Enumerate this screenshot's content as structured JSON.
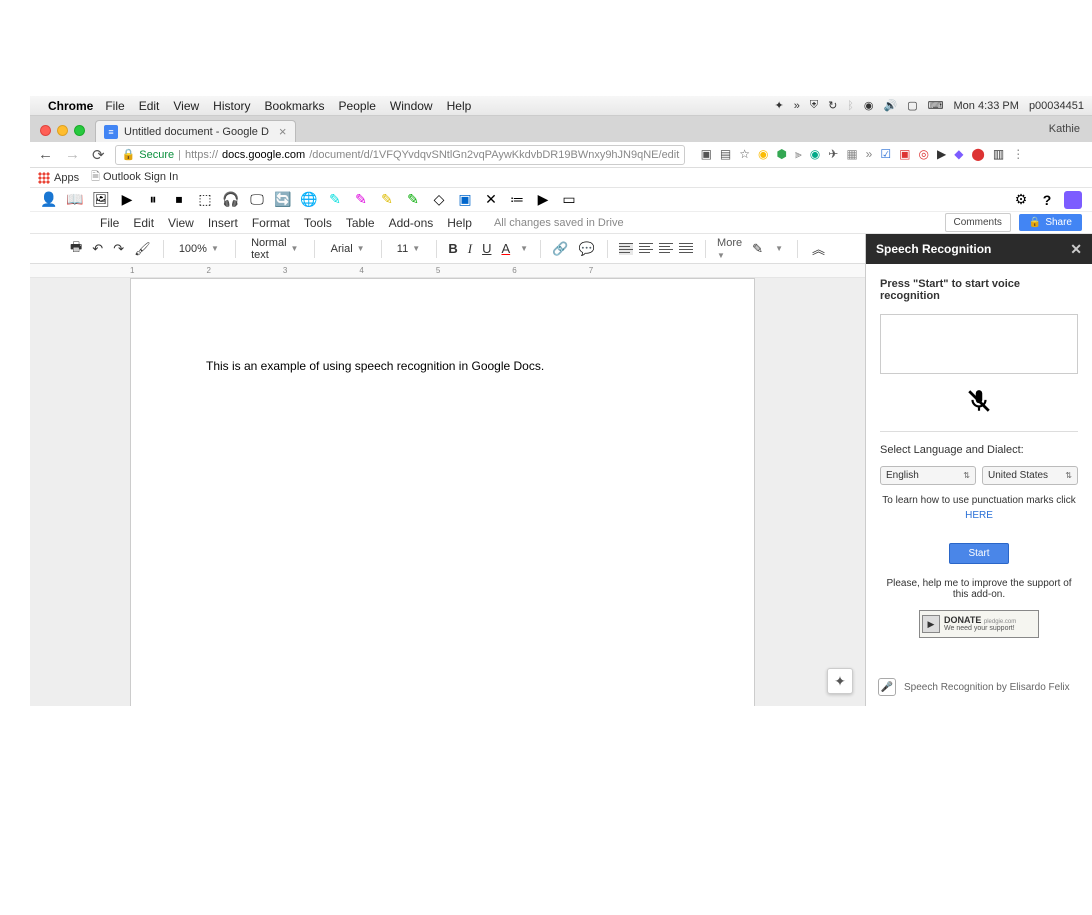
{
  "mac_menubar": {
    "app": "Chrome",
    "items": [
      "File",
      "Edit",
      "View",
      "History",
      "Bookmarks",
      "People",
      "Window",
      "Help"
    ],
    "clock": "Mon 4:33 PM",
    "user": "p00034451"
  },
  "browser": {
    "tab_title": "Untitled document - Google D",
    "user_label": "Kathie",
    "secure_label": "Secure",
    "url_prefix": "https://",
    "url_domain": "docs.google.com",
    "url_path": "/document/d/1VFQYvdqvSNtlGn2vqPAywKkdvbDR19BWnxy9hJN9qNE/edit",
    "bookmarks": {
      "apps": "Apps",
      "outlook": "Outlook Sign In"
    }
  },
  "docs": {
    "menus": [
      "File",
      "Edit",
      "View",
      "Insert",
      "Format",
      "Tools",
      "Table",
      "Add-ons",
      "Help"
    ],
    "save_status": "All changes saved in Drive",
    "comments_btn": "Comments",
    "share_btn": "Share",
    "toolbar": {
      "zoom": "100%",
      "style": "Normal text",
      "font": "Arial",
      "size": "11",
      "more": "More"
    },
    "ruler": [
      "1",
      "2",
      "3",
      "4",
      "5",
      "6",
      "7"
    ],
    "body": "This is an example of using speech recognition in Google Docs."
  },
  "speech": {
    "title": "Speech Recognition",
    "instruction": "Press \"Start\" to start voice recognition",
    "lang_label": "Select Language and Dialect:",
    "language": "English",
    "dialect": "United States",
    "punct_text": "To learn how to use punctuation marks click",
    "here": "HERE",
    "start": "Start",
    "help": "Please, help me to improve the support of this add-on.",
    "donate": "DONATE",
    "donate_sub": "We need your support!",
    "pledgie": "pledgie.com",
    "footer": "Speech Recognition by Elisardo Felix"
  }
}
